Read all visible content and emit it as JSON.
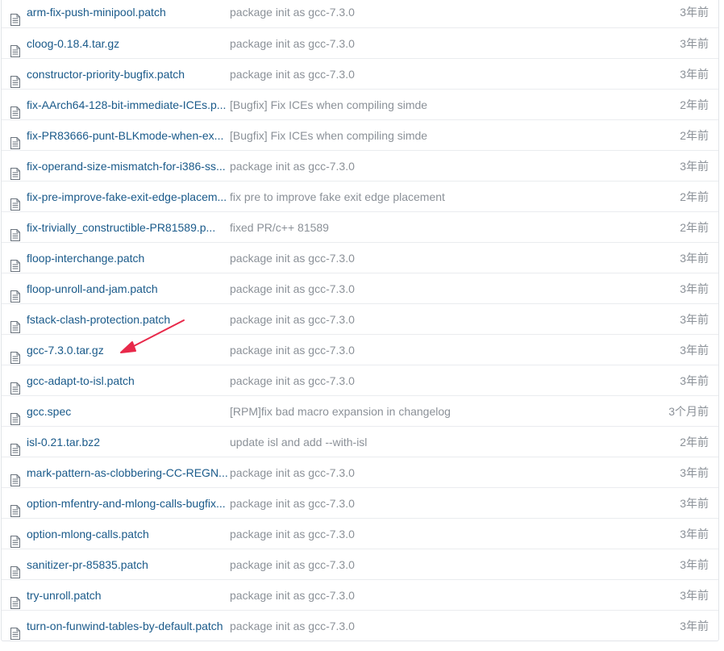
{
  "colors": {
    "link": "#1a5a8a",
    "muted": "#8b9198",
    "border": "#eaecef",
    "annotation_arrow": "#e8294a"
  },
  "file_icon": "file-text-icon",
  "files": [
    {
      "name": "arm-fix-push-minipool.patch",
      "message": "package init as gcc-7.3.0",
      "age": "3年前"
    },
    {
      "name": "cloog-0.18.4.tar.gz",
      "message": "package init as gcc-7.3.0",
      "age": "3年前"
    },
    {
      "name": "constructor-priority-bugfix.patch",
      "message": "package init as gcc-7.3.0",
      "age": "3年前"
    },
    {
      "name": "fix-AArch64-128-bit-immediate-ICEs.p...",
      "message": "[Bugfix] Fix ICEs when compiling simde",
      "age": "2年前"
    },
    {
      "name": "fix-PR83666-punt-BLKmode-when-ex...",
      "message": "[Bugfix] Fix ICEs when compiling simde",
      "age": "2年前"
    },
    {
      "name": "fix-operand-size-mismatch-for-i386-ss...",
      "message": "package init as gcc-7.3.0",
      "age": "3年前"
    },
    {
      "name": "fix-pre-improve-fake-exit-edge-placem...",
      "message": "fix pre to improve fake exit edge placement",
      "age": "2年前"
    },
    {
      "name": "fix-trivially_constructible-PR81589.p...",
      "message": "fixed PR/c++ 81589",
      "age": "2年前"
    },
    {
      "name": "floop-interchange.patch",
      "message": "package init as gcc-7.3.0",
      "age": "3年前"
    },
    {
      "name": "floop-unroll-and-jam.patch",
      "message": "package init as gcc-7.3.0",
      "age": "3年前"
    },
    {
      "name": "fstack-clash-protection.patch",
      "message": "package init as gcc-7.3.0",
      "age": "3年前"
    },
    {
      "name": "gcc-7.3.0.tar.gz",
      "message": "package init as gcc-7.3.0",
      "age": "3年前"
    },
    {
      "name": "gcc-adapt-to-isl.patch",
      "message": "package init as gcc-7.3.0",
      "age": "3年前"
    },
    {
      "name": "gcc.spec",
      "message": "[RPM]fix bad macro expansion in changelog",
      "age": "3个月前"
    },
    {
      "name": "isl-0.21.tar.bz2",
      "message": "update isl and add --with-isl",
      "age": "2年前"
    },
    {
      "name": "mark-pattern-as-clobbering-CC-REGN...",
      "message": "package init as gcc-7.3.0",
      "age": "3年前"
    },
    {
      "name": "option-mfentry-and-mlong-calls-bugfix...",
      "message": "package init as gcc-7.3.0",
      "age": "3年前"
    },
    {
      "name": "option-mlong-calls.patch",
      "message": "package init as gcc-7.3.0",
      "age": "3年前"
    },
    {
      "name": "sanitizer-pr-85835.patch",
      "message": "package init as gcc-7.3.0",
      "age": "3年前"
    },
    {
      "name": "try-unroll.patch",
      "message": "package init as gcc-7.3.0",
      "age": "3年前"
    },
    {
      "name": "turn-on-funwind-tables-by-default.patch",
      "message": "package init as gcc-7.3.0",
      "age": "3年前"
    }
  ]
}
